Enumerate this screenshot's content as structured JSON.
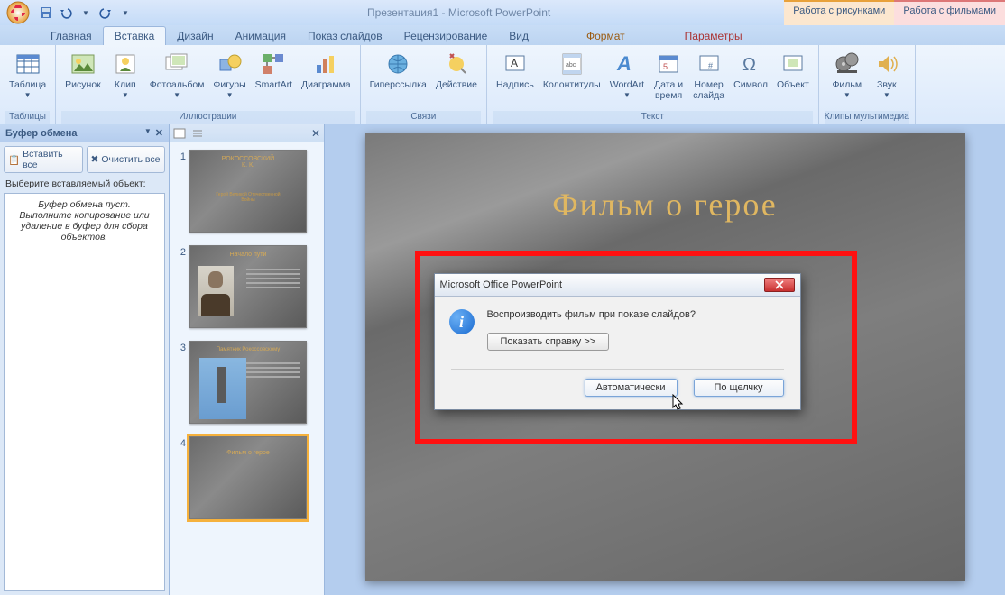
{
  "app_title": "Презентация1 - Microsoft PowerPoint",
  "context_tabs": {
    "pictures": "Работа с рисунками",
    "movies": "Работа с фильмами"
  },
  "tabs": {
    "home": "Главная",
    "insert": "Вставка",
    "design": "Дизайн",
    "anim": "Анимация",
    "slideshow": "Показ слайдов",
    "review": "Рецензирование",
    "view": "Вид",
    "format": "Формат",
    "params": "Параметры"
  },
  "ribbon": {
    "tables": {
      "table": "Таблица",
      "group": "Таблицы"
    },
    "illus": {
      "picture": "Рисунок",
      "clip": "Клип",
      "album": "Фотоальбом",
      "shapes": "Фигуры",
      "smartart": "SmartArt",
      "chart": "Диаграмма",
      "group": "Иллюстрации"
    },
    "links": {
      "hyperlink": "Гиперссылка",
      "action": "Действие",
      "group": "Связи"
    },
    "text": {
      "textbox": "Надпись",
      "headerfooter": "Колонтитулы",
      "wordart": "WordArt",
      "datetime": "Дата и\nвремя",
      "slidenum": "Номер\nслайда",
      "symbol": "Символ",
      "object": "Объект",
      "group": "Текст"
    },
    "media": {
      "movie": "Фильм",
      "sound": "Звук",
      "group": "Клипы мультимедиа"
    }
  },
  "clipboard": {
    "title": "Буфер обмена",
    "paste_all": "Вставить все",
    "clear_all": "Очистить все",
    "prompt": "Выберите вставляемый объект:",
    "empty": "Буфер обмена пуст.\nВыполните копирование или удаление в буфер для сбора объектов."
  },
  "thumbs": {
    "n1": "1",
    "n2": "2",
    "n3": "3",
    "n4": "4",
    "s1_title": "РОКОССОВСКИЙ\nК. К.",
    "s1_sub": "Герой Великой Отечественной\nВойны",
    "s2_title": "Начало пути",
    "s3_title": "Памятник Рокоссовскому",
    "s4_title": "Фильм о герое"
  },
  "slide": {
    "title": "Фильм о герое"
  },
  "dialog": {
    "title": "Microsoft Office PowerPoint",
    "question": "Воспроизводить фильм при показе слайдов?",
    "help": "Показать справку >>",
    "auto": "Автоматически",
    "click": "По щелчку"
  }
}
